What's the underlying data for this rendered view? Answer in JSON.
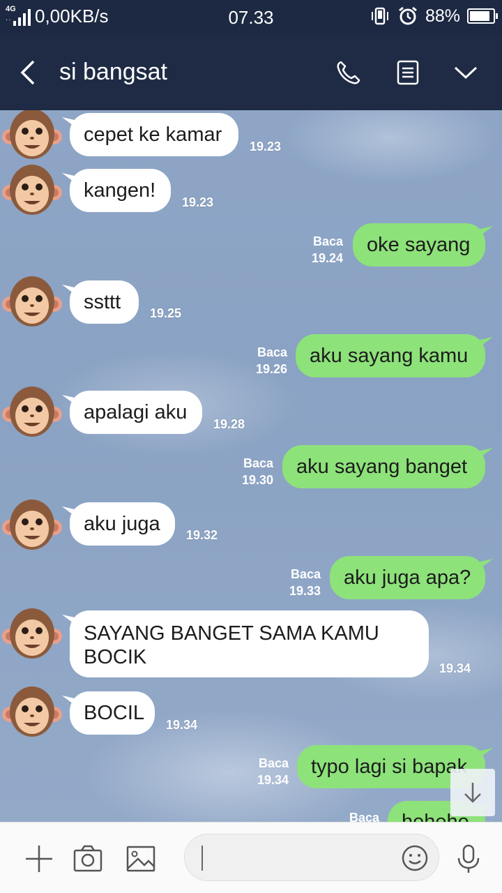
{
  "status_bar": {
    "network_type": "4G",
    "data_speed": "0,00KB/s",
    "time": "07.33",
    "battery_percent": "88%",
    "battery_level": 0.88
  },
  "header": {
    "contact_name": "si bangsat",
    "icons": [
      "back-icon",
      "phone-icon",
      "notes-icon",
      "chevron-down-icon"
    ]
  },
  "messages": [
    {
      "side": "in",
      "text": "cepet ke kamar",
      "time": "19.23"
    },
    {
      "side": "in",
      "text": "kangen!",
      "time": "19.23"
    },
    {
      "side": "out",
      "text": "oke sayang",
      "read": "Baca",
      "time": "19.24"
    },
    {
      "side": "in",
      "text": "ssttt",
      "time": "19.25"
    },
    {
      "side": "out",
      "text": "aku sayang kamu",
      "read": "Baca",
      "time": "19.26"
    },
    {
      "side": "in",
      "text": "apalagi aku",
      "time": "19.28"
    },
    {
      "side": "out",
      "text": "aku sayang banget",
      "read": "Baca",
      "time": "19.30"
    },
    {
      "side": "in",
      "text": "aku juga",
      "time": "19.32"
    },
    {
      "side": "out",
      "text": "aku juga apa?",
      "read": "Baca",
      "time": "19.33"
    },
    {
      "side": "in",
      "text": "SAYANG BANGET SAMA KAMU BOCIK",
      "time": "19.34"
    },
    {
      "side": "in",
      "text": "BOCIL",
      "time": "19.34"
    },
    {
      "side": "out",
      "text": "typo lagi si bapak",
      "read": "Baca",
      "time": "19.34"
    },
    {
      "side": "out",
      "text": "hehehe",
      "read": "Baca",
      "time": ""
    }
  ],
  "bottom_bar": {
    "input_value": "",
    "icons": [
      "plus-icon",
      "camera-icon",
      "image-icon",
      "emoji-icon",
      "microphone-icon"
    ]
  },
  "colors": {
    "header_bg": "#1f2b45",
    "outgoing_bubble": "#8de27a",
    "incoming_bubble": "#ffffff"
  }
}
